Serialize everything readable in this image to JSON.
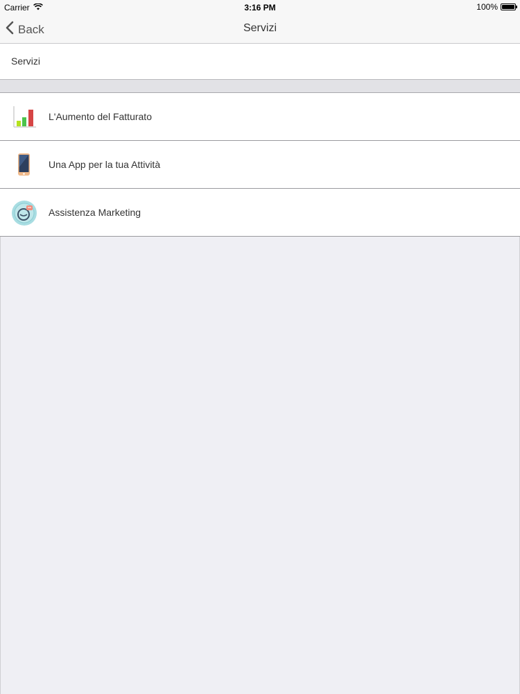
{
  "status_bar": {
    "carrier": "Carrier",
    "time": "3:16 PM",
    "battery": "100%",
    "battery_level": 1.0
  },
  "nav": {
    "back_label": "Back",
    "title": "Servizi"
  },
  "section": {
    "header": "Servizi"
  },
  "list": {
    "items": [
      {
        "label": "L'Aumento del Fatturato",
        "icon": "bar-chart-icon"
      },
      {
        "label": "Una App per la tua Attività",
        "icon": "smartphone-icon"
      },
      {
        "label": "Assistenza Marketing",
        "icon": "marketing-support-icon"
      }
    ]
  },
  "colors": {
    "background": "#efeff4",
    "bar_chart_green_light": "#b5e21f",
    "bar_chart_green": "#4cc34c",
    "bar_chart_red": "#d64545",
    "phone_body": "#2d3f5e",
    "phone_trim": "#f0b98a",
    "marketing_badge_bg": "#a8dde2",
    "marketing_accent": "#f28c7c"
  }
}
